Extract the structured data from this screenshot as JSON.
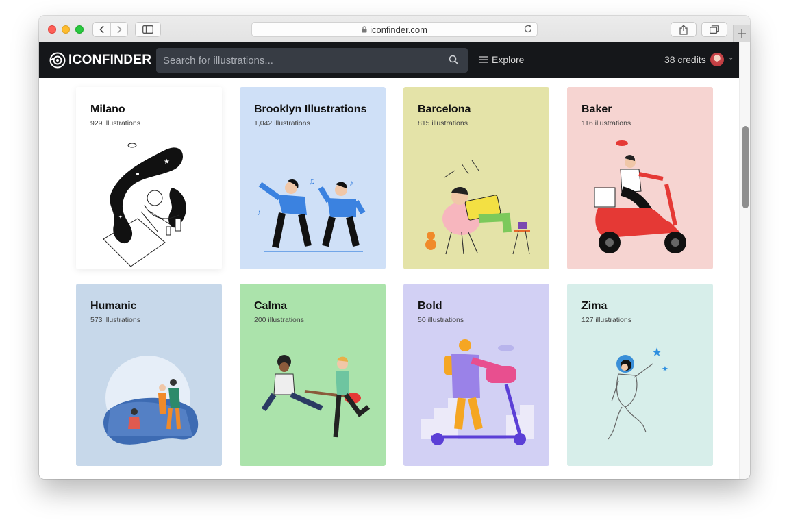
{
  "browser": {
    "url": "iconfinder.com"
  },
  "header": {
    "logo_text": "ICONFINDER",
    "search_placeholder": "Search for illustrations...",
    "explore_label": "Explore",
    "credits_label": "38 credits"
  },
  "cards": [
    {
      "title": "Milano",
      "count": "929 illustrations",
      "bg": "#ffffff"
    },
    {
      "title": "Brooklyn Illustrations",
      "count": "1,042 illustrations",
      "bg": "#cfe0f7"
    },
    {
      "title": "Barcelona",
      "count": "815 illustrations",
      "bg": "#e4e3a8"
    },
    {
      "title": "Baker",
      "count": "116 illustrations",
      "bg": "#f6d4d1"
    },
    {
      "title": "Humanic",
      "count": "573 illustrations",
      "bg": "#c7d8ea"
    },
    {
      "title": "Calma",
      "count": "200 illustrations",
      "bg": "#abe3ab"
    },
    {
      "title": "Bold",
      "count": "50 illustrations",
      "bg": "#d2d0f4"
    },
    {
      "title": "Zima",
      "count": "127 illustrations",
      "bg": "#d7eeea"
    }
  ],
  "icons": {
    "lock": "lock-icon",
    "reload": "reload-icon",
    "search": "search-icon",
    "menu": "hamburger-icon"
  }
}
